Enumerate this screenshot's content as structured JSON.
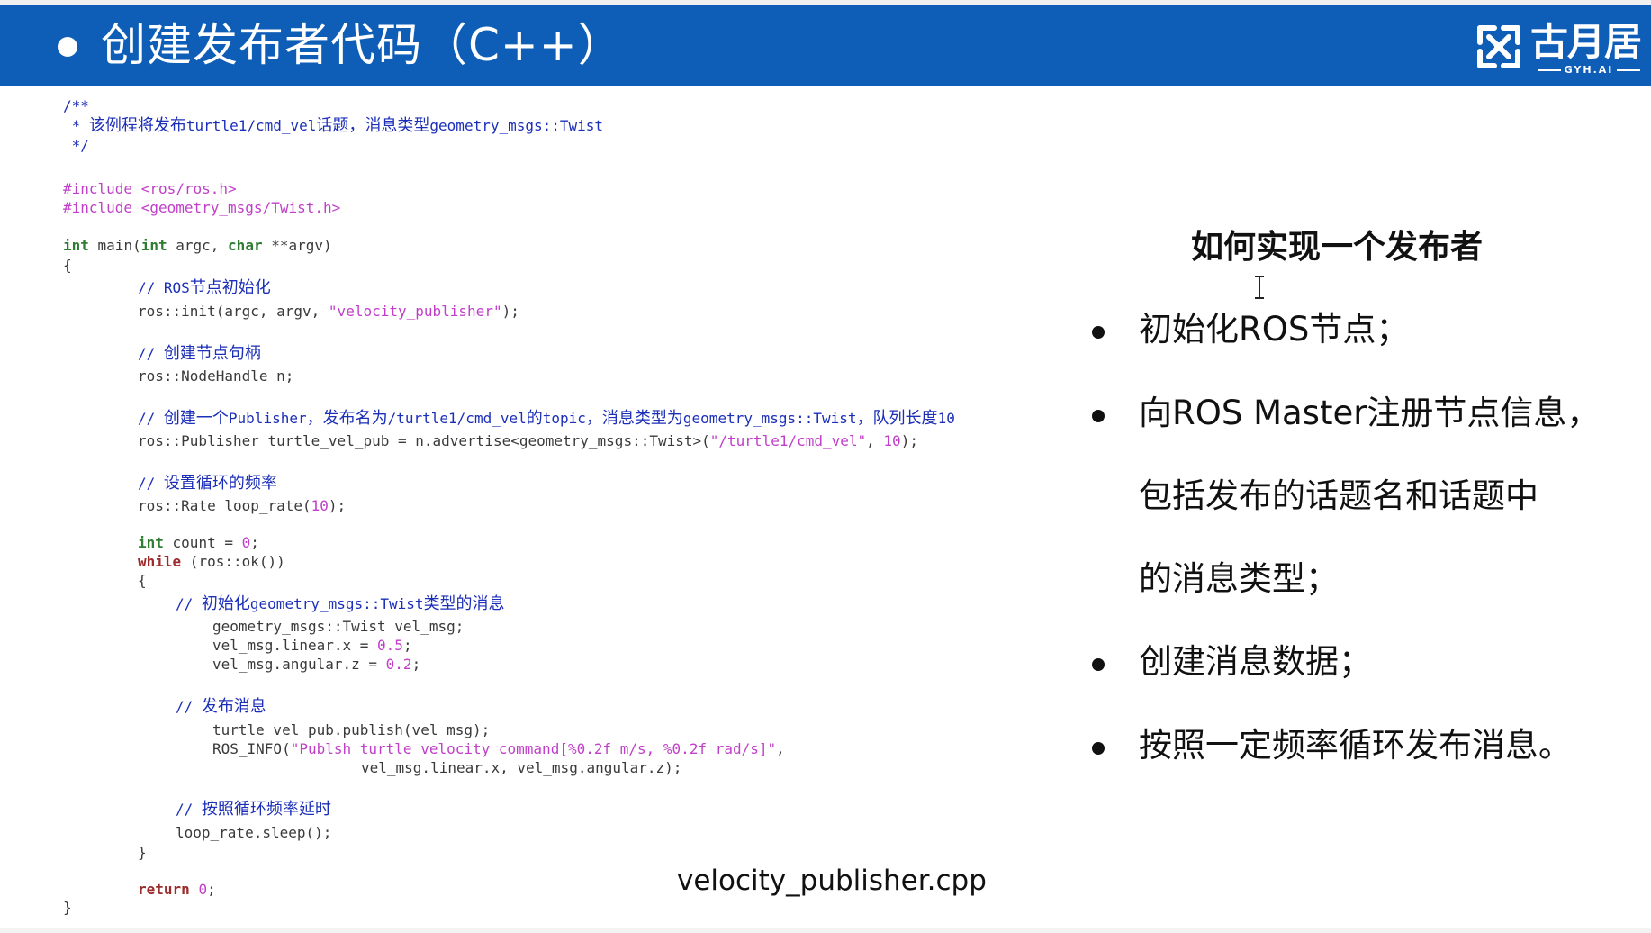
{
  "slide": {
    "title": "创建发布者代码（C++）",
    "accent_color": "#0e5eb8"
  },
  "logo": {
    "text": "古月居",
    "subtext": "GYH.AI",
    "icon": "gyh-logo-icon"
  },
  "code": {
    "l1": "/**",
    "l2_star": " * ",
    "l2_a": "该例程将发布",
    "l2_b": "turtle1/cmd_vel",
    "l2_c": "话题，消息类型",
    "l2_d": "geometry_msgs::Twist",
    "l3": " */",
    "l4": "#include <ros/ros.h>",
    "l5": "#include <geometry_msgs/Twist.h>",
    "l6_kw": "int",
    "l6_a": " main(",
    "l6_kw2": "int",
    "l6_b": " argc, ",
    "l6_kw3": "char",
    "l6_c": " **argv)",
    "l7": "{",
    "c1_slash": "// ",
    "c1_a": "ROS",
    "c1_b": "节点初始化",
    "s1_a": "ros::init(argc, argv, ",
    "s1_str": "\"velocity_publisher\"",
    "s1_b": ");",
    "c2_slash": "// ",
    "c2_a": "创建节点句柄",
    "s2": "ros::NodeHandle n;",
    "c3_slash": "// ",
    "c3_a": "创建一个",
    "c3_b": "Publisher",
    "c3_c": "，发布名为",
    "c3_d": "/turtle1/cmd_vel",
    "c3_e": "的",
    "c3_f": "topic",
    "c3_g": "，消息类型为",
    "c3_h": "geometry_msgs::Twist",
    "c3_i": "，队列长度",
    "c3_j": "10",
    "s3_a": "ros::Publisher turtle_vel_pub = n.advertise<geometry_msgs::Twist>(",
    "s3_str": "\"/turtle1/cmd_vel\"",
    "s3_b": ", ",
    "s3_num": "10",
    "s3_c": ");",
    "c4_slash": "// ",
    "c4_a": "设置循环的频率",
    "s4_a": "ros::Rate loop_rate(",
    "s4_num": "10",
    "s4_b": ");",
    "s5_kw": "int",
    "s5_a": " count = ",
    "s5_num": "0",
    "s5_b": ";",
    "s6_kw": "while",
    "s6_a": " (ros::ok())",
    "s7": "{",
    "c5_slash": "// ",
    "c5_a": "初始化",
    "c5_b": "geometry_msgs::Twist",
    "c5_c": "类型的消息",
    "s8": "geometry_msgs::Twist vel_msg;",
    "s9_a": "vel_msg.linear.x = ",
    "s9_num": "0.5",
    "s9_b": ";",
    "s10_a": "vel_msg.angular.z = ",
    "s10_num": "0.2",
    "s10_b": ";",
    "c6_slash": "// ",
    "c6_a": "发布消息",
    "s11": "turtle_vel_pub.publish(vel_msg);",
    "s12_a": "ROS_INFO(",
    "s12_str": "\"Publsh turtle velocity command[%0.2f m/s, %0.2f rad/s]\"",
    "s12_b": ",",
    "s13": "vel_msg.linear.x, vel_msg.angular.z);",
    "c7_slash": "// ",
    "c7_a": "按照循环频率延时",
    "s14": "loop_rate.sleep();",
    "s15": "}",
    "s16_kw": "return",
    "s16_a": " ",
    "s16_num": "0",
    "s16_b": ";",
    "s17": "}"
  },
  "filename": "velocity_publisher.cpp",
  "panel": {
    "title": "如何实现一个发布者",
    "points": [
      "初始化ROS节点；",
      "向ROS  Master注册节点信息，",
      "包括发布的话题名和话题中",
      "的消息类型；",
      "创建消息数据；",
      "按照一定频率循环发布消息。"
    ]
  },
  "colors": {
    "comment": "#1c2fb8",
    "keyword": "#2e7d32",
    "keyword_flow": "#9c2c2c",
    "string": "#c03fc8"
  }
}
